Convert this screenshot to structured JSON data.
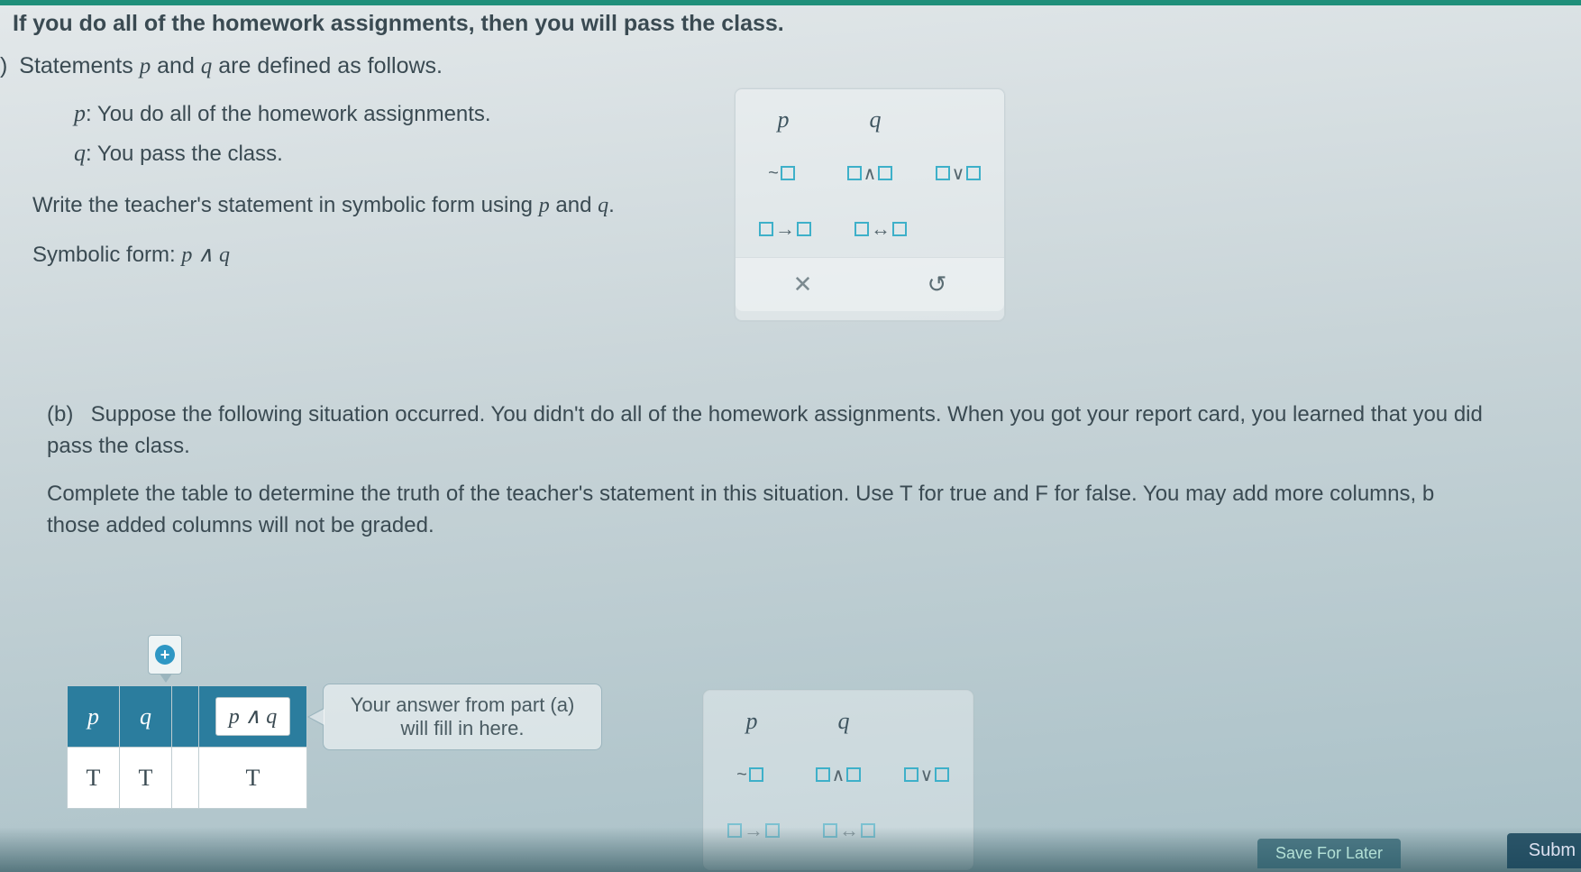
{
  "header_statement": "If you do all of the homework assignments, then you will pass the class.",
  "part_a": {
    "label": ")",
    "intro_prefix": "Statements ",
    "p_var": "p",
    "and_word": " and ",
    "q_var": "q",
    "intro_suffix": " are defined as follows.",
    "p_label": "p",
    "p_def": ": You do all of the homework assignments.",
    "q_label": "q",
    "q_def": ": You pass the class.",
    "instruction_1": "Write the teacher's statement in symbolic form using ",
    "instruction_p": "p",
    "instruction_and": " and ",
    "instruction_q": "q",
    "instruction_end": ".",
    "symform_label": "Symbolic form:  ",
    "symform_value": "p ∧ q"
  },
  "toolbox": {
    "p": "p",
    "q": "q",
    "not": "~",
    "and": "∧",
    "or": "∨",
    "cond": "→",
    "bicond": "↔",
    "clear": "✕",
    "reset": "↺"
  },
  "part_b": {
    "label": "(b)",
    "text1": "Suppose the following situation occurred. You didn't do all of the homework assignments. When you got your report card, you learned that you did",
    "text1b": "pass the class.",
    "text2": "Complete the table to determine the truth of the teacher's statement in this situation. Use T for true and F for false. You may add more columns, b",
    "text2b": "those added columns will not be graded."
  },
  "truth_table": {
    "add_col_icon": "+",
    "hdr_p": "p",
    "hdr_q": "q",
    "hdr_expr": "p ∧ q",
    "row": {
      "p": "T",
      "q": "T",
      "expr": "T"
    }
  },
  "callout": "Your answer from part (a) will fill in here.",
  "footer": {
    "save": "Save For Later",
    "submit": "Subm"
  }
}
